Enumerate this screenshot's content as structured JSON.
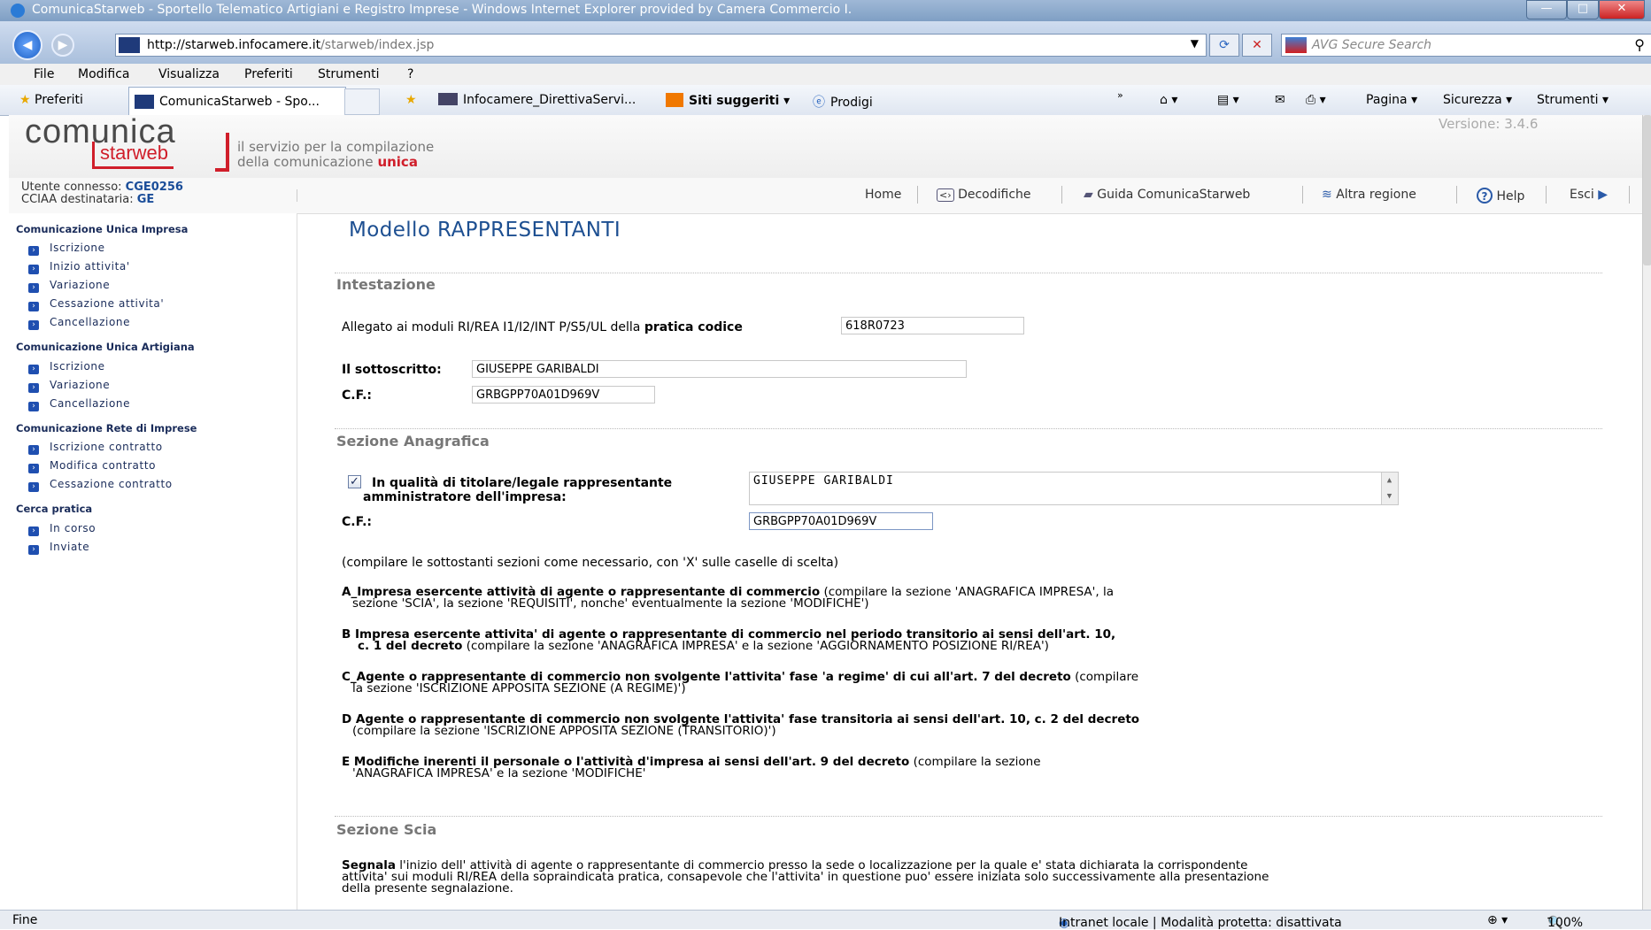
{
  "browser": {
    "title": "ComunicaStarweb - Sportello Telematico Artigiani e Registro Imprese - Windows Internet Explorer provided by Camera Commercio I.",
    "url_host": "http://starweb.infocamere.it",
    "url_path": "/starweb/index.jsp",
    "search_placeholder": "AVG Secure Search",
    "window_buttons": {
      "minimize": "—",
      "maximize": "□",
      "close": "✕"
    },
    "menu": [
      "File",
      "Modifica",
      "Visualizza",
      "Preferiti",
      "Strumenti",
      "?"
    ],
    "favorites": {
      "preferiti": "Preferiti",
      "tab": "ComunicaStarweb - Spo...",
      "link1": "Infocamere_DirettivaServi...",
      "link2": "Siti suggeriti ▾",
      "link3": "Prodigi",
      "pagina": "Pagina ▾",
      "sicurezza": "Sicurezza ▾",
      "strumenti": "Strumenti ▾"
    },
    "status": {
      "left": "Fine",
      "zone": "Intranet locale | Modalità protetta: disattivata",
      "zoom": "100%"
    }
  },
  "app": {
    "logo_top": "comunica",
    "logo_bottom": "starweb",
    "tagline1": "il servizio per la compilazione",
    "tagline2_prefix": "della comunicazione ",
    "tagline2_accent": "unica",
    "version": "Versione: 3.4.6",
    "user_label": "Utente connesso: ",
    "user_value": "CGE0256",
    "cciaa_label": "CCIAA destinataria: ",
    "cciaa_value": "GE",
    "nav": {
      "home": "Home",
      "decodifiche": "Decodifiche",
      "guida": "Guida ComunicaStarweb",
      "regione": "Altra regione",
      "help": "Help",
      "esci": "Esci"
    }
  },
  "sidebar": {
    "g1": "Comunicazione Unica Impresa",
    "g1_items": [
      "Iscrizione",
      "Inizio attivita'",
      "Variazione",
      "Cessazione attivita'",
      "Cancellazione"
    ],
    "g2": "Comunicazione Unica Artigiana",
    "g2_items": [
      "Iscrizione",
      "Variazione",
      "Cancellazione"
    ],
    "g3": "Comunicazione Rete di Imprese",
    "g3_items": [
      "Iscrizione contratto",
      "Modifica contratto",
      "Cessazione contratto"
    ],
    "g4": "Cerca pratica",
    "g4_items": [
      "In corso",
      "Inviate"
    ]
  },
  "form": {
    "title": "Modello RAPPRESENTANTI",
    "sec_intestazione": "Intestazione",
    "allegato_text": "Allegato ai moduli RI/REA I1/I2/INT P/S5/UL della ",
    "allegato_bold": "pratica codice",
    "pratica_codice": "618R0723",
    "sottoscritto_label": "Il sottoscritto:",
    "sottoscritto_value": "GIUSEPPE GARIBALDI",
    "cf_label": "C.F.:",
    "cf_value": "GRBGPP70A01D969V",
    "sec_anagrafica": "Sezione Anagrafica",
    "qualita_line1": "In qualità di titolare/legale rappresentante",
    "qualita_line2": "amministratore dell'impresa:",
    "qualita_value": "GIUSEPPE GARIBALDI",
    "cf2_label": "C.F.:",
    "cf2_value": "GRBGPP70A01D969V",
    "note": "(compilare le sottostanti sezioni come necessario, con 'X' sulle caselle di scelta)",
    "optA_b": "A_Impresa esercente attività di agente o rappresentante di commercio",
    "optA_1": " (compilare la sezione 'ANAGRAFICA IMPRESA', la",
    "optA_2": "sezione 'SCIA', la sezione 'REQUISITI', nonche' eventualmente la sezione 'MODIFICHE')",
    "optB_b1": "B Impresa esercente attivita' di agente o rappresentante di commercio nel periodo transitorio ai sensi dell'art. 10,",
    "optB_b2": "c. 1 del decreto",
    "optB_2": " (compilare la sezione 'ANAGRAFICA IMPRESA' e la sezione 'AGGIORNAMENTO POSIZIONE RI/REA')",
    "optC_b": "C_Agente o rappresentante di commercio non svolgente l'attivita' fase 'a regime' di cui all'art. 7 del decreto",
    "optC_1": " (compilare",
    "optC_2": "la sezione 'ISCRIZIONE APPOSITA SEZIONE (A REGIME)')",
    "optD_b": "D Agente o rappresentante di commercio non svolgente l'attivita' fase transitoria ai sensi dell'art. 10, c. 2 del decreto",
    "optD_2": "(compilare la sezione 'ISCRIZIONE APPOSITA SEZIONE (TRANSITORIO)')",
    "optE_b": "E Modifiche inerenti il personale o l'attività d'impresa ai sensi dell'art. 9 del decreto",
    "optE_1": " (compilare la sezione",
    "optE_2": "'ANAGRAFICA IMPRESA' e la sezione 'MODIFICHE'",
    "sec_scia": "Sezione Scia",
    "scia_b": "Segnala",
    "scia_1": " l'inizio dell' attività di agente o rappresentante di commercio presso la sede o localizzazione per la quale e' stata dichiarata la corrispondente",
    "scia_2": "attivita' sui moduli RI/REA della sopraindicata pratica, consapevole che l'attivita' in questione puo' essere iniziata solo successivamente alla presentazione",
    "scia_3": "della presente segnalazione."
  }
}
